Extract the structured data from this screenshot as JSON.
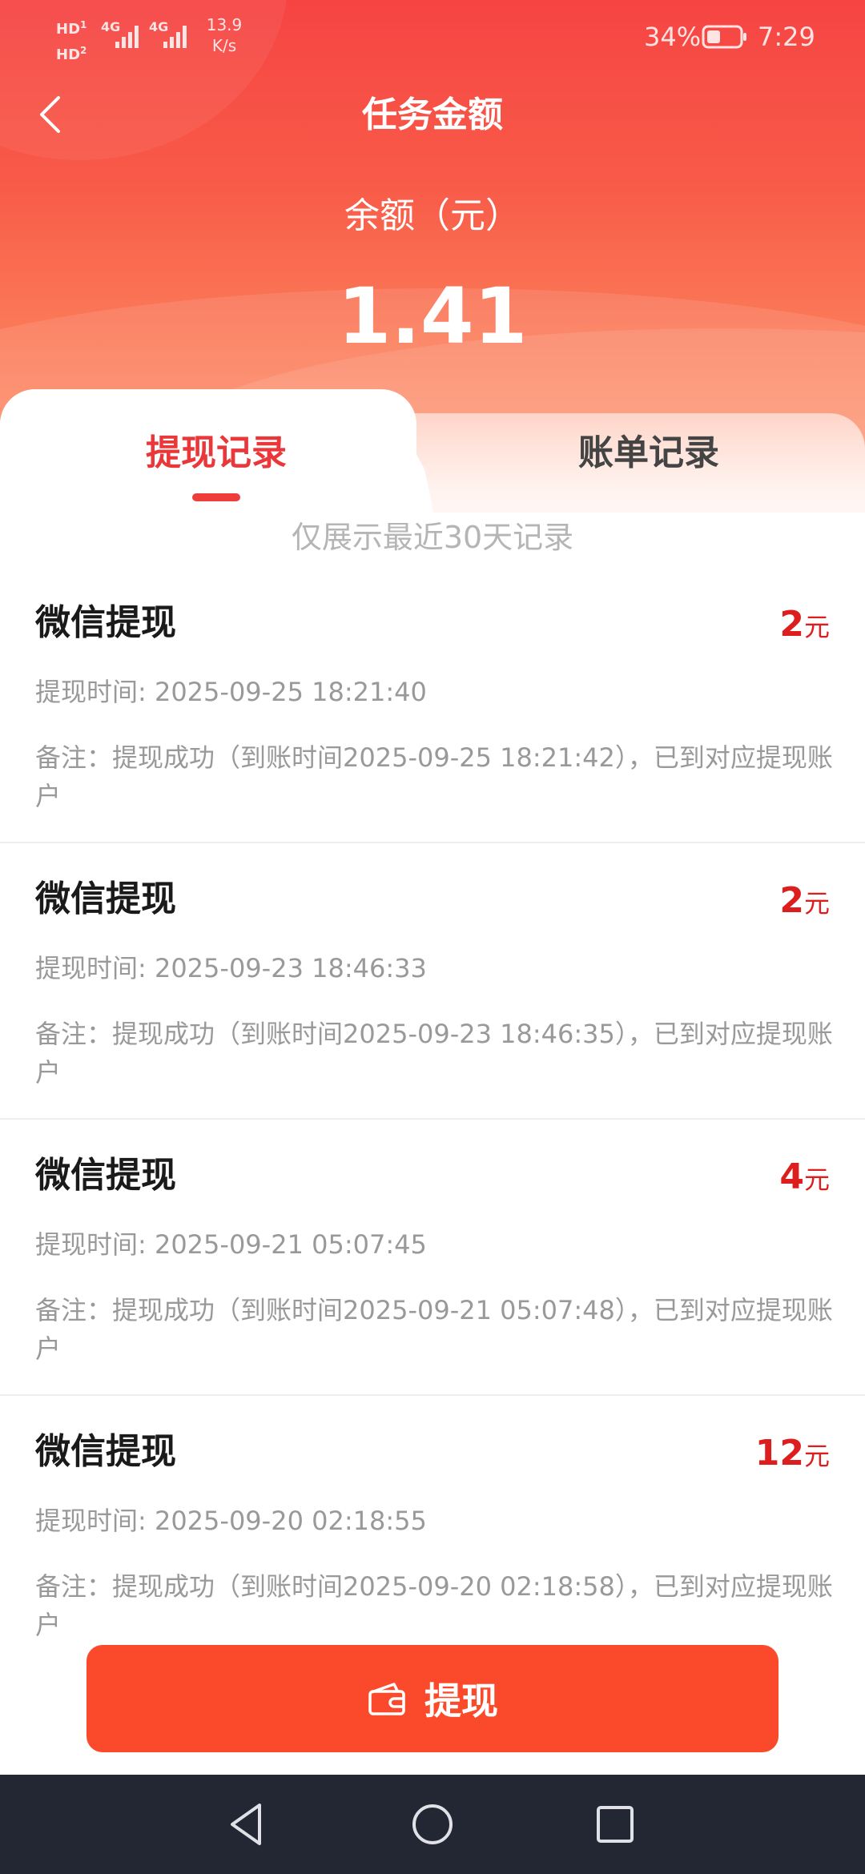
{
  "status_bar": {
    "hd1": "HD",
    "hd1_sub": "1",
    "hd2": "HD",
    "hd2_sub": "2",
    "net1": "4G",
    "net2": "4G",
    "net_speed_value": "13.9",
    "net_speed_unit": "K/s",
    "battery": "34%",
    "time": "7:29"
  },
  "header": {
    "title": "任务金额",
    "balance_label": "余额（元）",
    "balance_value": "1.41"
  },
  "tabs": [
    {
      "label": "提现记录",
      "active": true
    },
    {
      "label": "账单记录",
      "active": false
    }
  ],
  "hint": "仅展示最近30天记录",
  "records": [
    {
      "title": "微信提现",
      "amount": "2",
      "unit": "元",
      "time": "提现时间: 2025-09-25 18:21:40",
      "note": "备注：提现成功（到账时间2025-09-25 18:21:42），已到对应提现账户"
    },
    {
      "title": "微信提现",
      "amount": "2",
      "unit": "元",
      "time": "提现时间: 2025-09-23 18:46:33",
      "note": "备注：提现成功（到账时间2025-09-23 18:46:35），已到对应提现账户"
    },
    {
      "title": "微信提现",
      "amount": "4",
      "unit": "元",
      "time": "提现时间: 2025-09-21 05:07:45",
      "note": "备注：提现成功（到账时间2025-09-21 05:07:48），已到对应提现账户"
    },
    {
      "title": "微信提现",
      "amount": "12",
      "unit": "元",
      "time": "提现时间: 2025-09-20 02:18:55",
      "note": "备注：提现成功（到账时间2025-09-20 02:18:58），已到对应提现账户"
    }
  ],
  "withdraw_button": {
    "label": "提现",
    "icon": "wallet-icon"
  },
  "colors": {
    "header_red": "#f64443",
    "accent_red": "#e9373a",
    "amount_red": "#dd1e1e",
    "button_orange": "#fb4a2b",
    "navbar": "#232733"
  }
}
